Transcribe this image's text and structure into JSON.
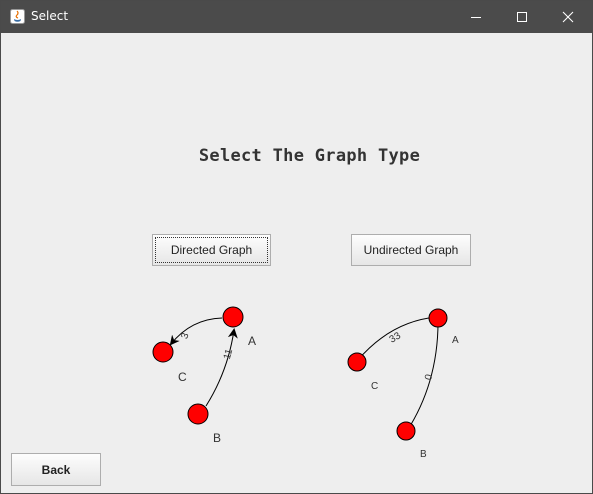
{
  "window": {
    "title": "Select"
  },
  "heading": "Select The Graph Type",
  "buttons": {
    "directed": "Directed Graph",
    "undirected": "Undirected Graph",
    "back": "Back"
  },
  "directed_graph": {
    "nodes": {
      "a": "A",
      "b": "B",
      "c": "C"
    },
    "edges": {
      "ac_weight": "3",
      "ba_weight": "11"
    }
  },
  "undirected_graph": {
    "nodes": {
      "a": "A",
      "b": "B",
      "c": "C"
    },
    "edges": {
      "ac_weight": "33",
      "ab_weight": "0"
    }
  },
  "colors": {
    "node_fill": "#ff0000",
    "titlebar": "#4b4b4b",
    "window_bg": "#eeeeee"
  }
}
